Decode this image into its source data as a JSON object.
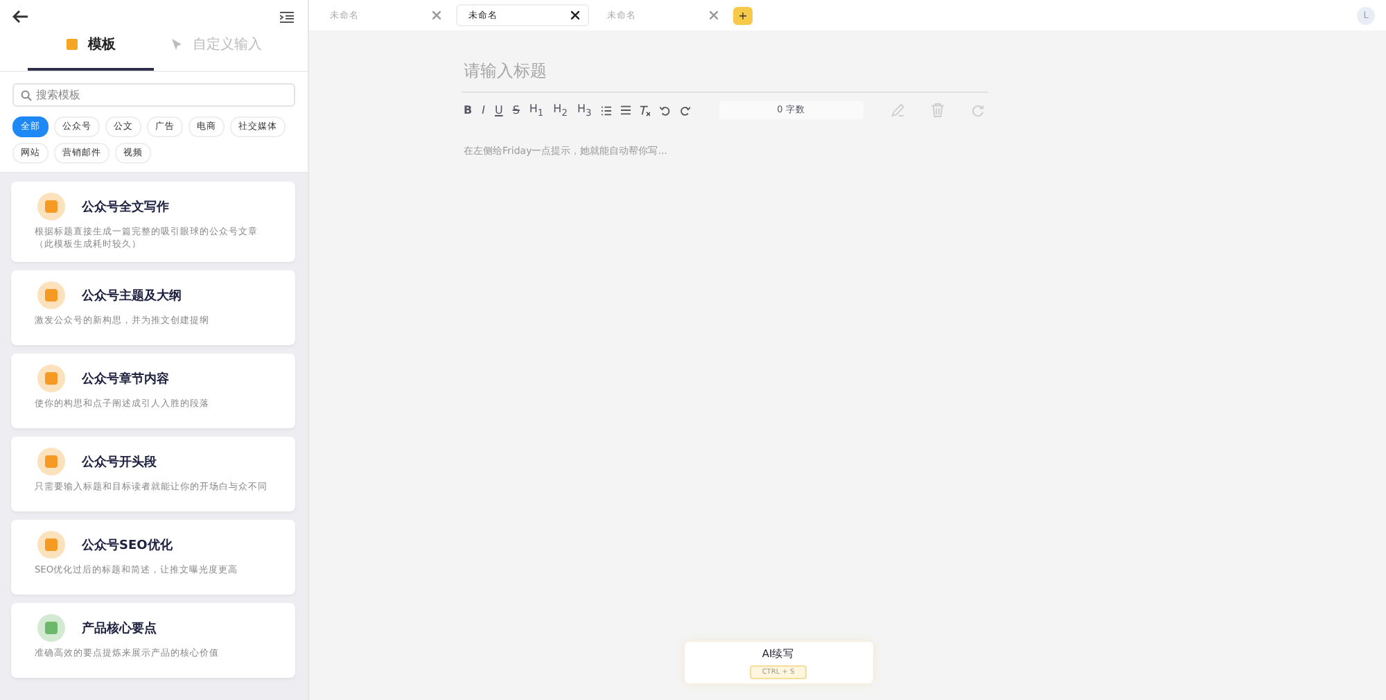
{
  "sidebar": {
    "tabs": [
      {
        "label": "模板",
        "selected": true
      },
      {
        "label": "自定义输入",
        "selected": false
      }
    ],
    "search": {
      "placeholder": "搜索模板"
    },
    "filters": [
      {
        "label": "全部",
        "selected": true
      },
      {
        "label": "公众号",
        "selected": false
      },
      {
        "label": "公文",
        "selected": false
      },
      {
        "label": "广告",
        "selected": false
      },
      {
        "label": "电商",
        "selected": false
      },
      {
        "label": "社交媒体",
        "selected": false
      },
      {
        "label": "网站",
        "selected": false
      },
      {
        "label": "营销邮件",
        "selected": false
      },
      {
        "label": "视频",
        "selected": false
      }
    ],
    "templates": [
      {
        "title": "公众号全文写作",
        "description": "根据标题直接生成一篇完整的吸引眼球的公众号文章（此模板生成耗时较久）",
        "color": "#f59a23"
      },
      {
        "title": "公众号主题及大纲",
        "description": "激发公众号的新构思，并为推文创建提纲",
        "color": "#f59a23"
      },
      {
        "title": "公众号章节内容",
        "description": "使你的构思和点子阐述成引人入胜的段落",
        "color": "#f59a23"
      },
      {
        "title": "公众号开头段",
        "description": "只需要输入标题和目标读者就能让你的开场白与众不同",
        "color": "#f59a23"
      },
      {
        "title": "公众号SEO优化",
        "description": "SEO优化过后的标题和简述，让推文曝光度更高",
        "color": "#f59a23"
      },
      {
        "title": "产品核心要点",
        "description": "准确高效的要点提炼来展示产品的核心价值",
        "color": "#6cb86a"
      }
    ]
  },
  "doc_tabs": [
    {
      "label": "未命名",
      "selected": false
    },
    {
      "label": "未命名",
      "selected": true
    },
    {
      "label": "未命名",
      "selected": false
    }
  ],
  "add_tab": "+",
  "avatar": "L",
  "editor": {
    "title_placeholder": "请输入标题",
    "toolbar": [
      {
        "kind": "text",
        "label": "B"
      },
      {
        "kind": "text",
        "label": "I"
      },
      {
        "kind": "text",
        "label": "U"
      },
      {
        "kind": "text",
        "label": "S"
      },
      {
        "kind": "text",
        "label": "H$_{1}$"
      },
      {
        "kind": "text",
        "label": "H$_{2}$"
      },
      {
        "kind": "text",
        "label": "H$_{3}$"
      },
      {
        "kind": "bullet"
      },
      {
        "kind": "align"
      },
      {
        "kind": "clear"
      },
      {
        "kind": "undo"
      },
      {
        "kind": "redo"
      }
    ],
    "word_count": "0 字数",
    "body_placeholder": "在左侧给Friday一点提示，她就能自动帮你写..."
  },
  "ai_panel": {
    "title": "AI续写",
    "shortcut": "CTRL + S"
  }
}
